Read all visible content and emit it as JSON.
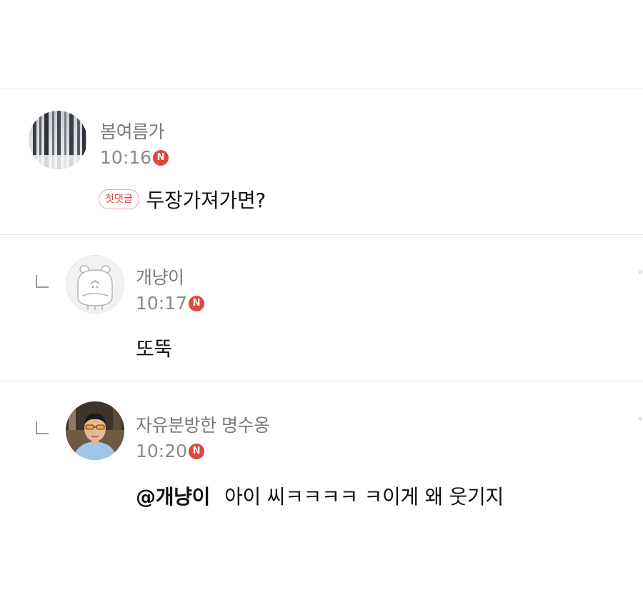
{
  "comments": [
    {
      "author": "봄여름가",
      "time": "10:16",
      "new_badge": "N",
      "first_comment_badge": "첫댓글",
      "text": "두장가져가면?",
      "avatar_icon": "forest-photo-avatar"
    },
    {
      "author": "개냥이",
      "time": "10:17",
      "new_badge": "N",
      "text": "또뚝",
      "is_reply": true,
      "avatar_icon": "hippo-cartoon-avatar"
    },
    {
      "author": "자유분방한 명수옹",
      "time": "10:20",
      "new_badge": "N",
      "mention": "@개냥이",
      "text": "아이 씨ㅋㅋㅋㅋ ㅋ이게 왜 웃기지",
      "is_reply": true,
      "avatar_icon": "person-photo-avatar"
    }
  ],
  "colors": {
    "accent": "#e0463f",
    "meta_text": "#7a7a7a",
    "divider": "#e4e4e4"
  }
}
